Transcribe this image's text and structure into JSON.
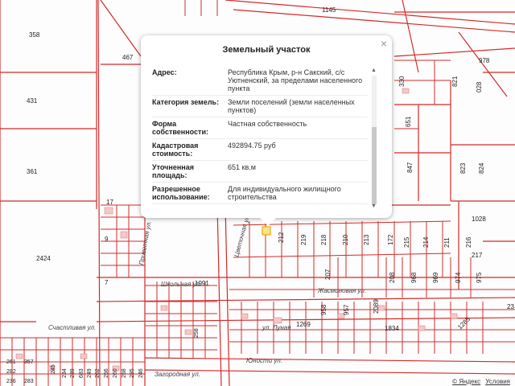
{
  "popup": {
    "title": "Земельный участок",
    "close_symbol": "×",
    "rows": [
      {
        "label": "Адрес:",
        "value": "Республика Крым, р-н Сакский, с/с Уютненский, за пределами населенного пункта"
      },
      {
        "label": "Категория земель:",
        "value": "Земли поселений (земли населенных пунктов)"
      },
      {
        "label": "Форма собственности:",
        "value": "Частная собственность"
      },
      {
        "label": "Кадастровая стоимость:",
        "value": "492894.75 руб"
      },
      {
        "label": "Уточненная площадь:",
        "value": "651 кв.м"
      },
      {
        "label": "Разрешенное использование:",
        "value": "Для индивидуального жилищного строительства"
      }
    ]
  },
  "map": {
    "line_color": "#d42a2a",
    "parcel_numbers": [
      "358",
      "467",
      "431",
      "361",
      "2424",
      "1145",
      "978",
      "821",
      "028",
      "330",
      "651",
      "847",
      "823",
      "824",
      "1028",
      "217",
      "212",
      "219",
      "218",
      "210",
      "213",
      "172",
      "215",
      "214",
      "211",
      "216",
      "207",
      "208",
      "968",
      "969",
      "974",
      "975",
      "958",
      "957",
      "2089",
      "1834",
      "1285",
      "1269",
      "1991",
      "23",
      "17",
      "9",
      "7"
    ],
    "parcel_labels_small": [
      "261",
      "357",
      "282",
      "236",
      "283",
      "245",
      "234",
      "239",
      "683",
      "249",
      "262",
      "256",
      "260",
      "258",
      "295",
      "258",
      "246"
    ],
    "streets": [
      "Приветная ул.",
      "Школьная ул.",
      "Жасминовая ул.",
      "ул. Луная",
      "Счастливая ул.",
      "Загородная ул.",
      "Цветочная ул.",
      "Юности ул."
    ]
  },
  "attribution": {
    "yandex": "© Яндекс",
    "terms": "Условия"
  }
}
